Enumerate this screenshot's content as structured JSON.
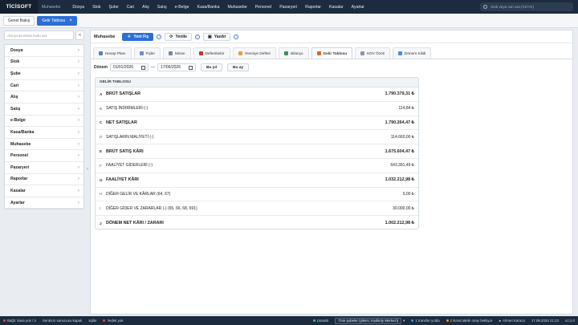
{
  "app": {
    "logo": "TİCİSOFT",
    "module": "Muhasebe"
  },
  "topmenu": [
    "Dosya",
    "Stok",
    "Şube",
    "Cari",
    "Alış",
    "Satış",
    "e-Belge",
    "Kasa/Banka",
    "Muhasebe",
    "Personel",
    "Pazaryeri",
    "Raporlar",
    "Kasalar",
    "Ayarlar"
  ],
  "search": {
    "placeholder": "Stok veya cari ara (Ctrl+K)"
  },
  "tabs": [
    {
      "label": "Genel Bakış"
    },
    {
      "label": "Gelir Tablosu"
    }
  ],
  "sidebar": {
    "search_placeholder": "Ara ya da ekran kodu yaz",
    "collapse": "«",
    "items": [
      "Dosya",
      "Stok",
      "Şube",
      "Cari",
      "Alış",
      "Satış",
      "e-Belge",
      "Kasa/Banka",
      "Muhasebe",
      "Personel",
      "Pazaryeri",
      "Raporlar",
      "Kasalar",
      "Ayarlar"
    ]
  },
  "toolbar": {
    "title": "Muhasebe",
    "new_label": "Yeni Fiş",
    "refresh_label": "Yenile",
    "print_label": "Yazdır"
  },
  "subtabs": [
    {
      "label": "Hesap Planı",
      "color": "#5b7fb5"
    },
    {
      "label": "Fişler",
      "color": "#6c8fc9"
    },
    {
      "label": "Mizan",
      "color": "#7a8899"
    },
    {
      "label": "Defterikebir",
      "color": "#c0392b"
    },
    {
      "label": "Yevmiye Defteri",
      "color": "#d9a441"
    },
    {
      "label": "Bilanço",
      "color": "#3b8f5a"
    },
    {
      "label": "Gelir Tablosu",
      "color": "#e0662b"
    },
    {
      "label": "KDV Özeti",
      "color": "#8a96a8"
    },
    {
      "label": "Dönem Kilidi",
      "color": "#4d8fd1"
    }
  ],
  "period": {
    "label": "Dönem",
    "start": "01/01/2026",
    "separator": "—",
    "end": "17/09/2026",
    "this_year": "Bu yıl",
    "this_month": "Bu ay"
  },
  "report": {
    "title": "GELİR TABLOSU",
    "rows": [
      {
        "code": "A",
        "label": "BRÜT SATIŞLAR",
        "value": "1.790.379,31 ₺",
        "bold": true
      },
      {
        "code": "B",
        "label": "SATIŞ İNDİRİMLERİ (-)",
        "value": "114,84 ₺",
        "bold": false
      },
      {
        "code": "C",
        "label": "NET SATIŞLAR",
        "value": "1.790.264,47 ₺",
        "bold": true
      },
      {
        "code": "D",
        "label": "SATIŞLARIN MALİYETİ (-)",
        "value": "114.660,00 ₺",
        "bold": false
      },
      {
        "code": "E",
        "label": "BRÜT SATIŞ KÂRI",
        "value": "1.675.604,47 ₺",
        "bold": true
      },
      {
        "code": "F",
        "label": "FAALİYET GİDERLERİ (-)",
        "value": "643.391,49 ₺",
        "bold": false
      },
      {
        "code": "G",
        "label": "FAALİYET KÂRI",
        "value": "1.032.212,98 ₺",
        "bold": true
      },
      {
        "code": "H",
        "label": "DİĞER GELİR VE KÂRLAR (64, 67)",
        "value": "0,00 ₺",
        "bold": false
      },
      {
        "code": "I",
        "label": "DİĞER GİDER VE ZARARLAR (-) (65, 66, 68, 691)",
        "value": "30.000,00 ₺",
        "bold": false
      },
      {
        "code": "J",
        "label": "DÖNEM NET KÂRI / ZARARI",
        "value": "1.002.212,98 ₺",
        "bold": true
      }
    ]
  },
  "statusbar": {
    "bagli": "Bağlı: kasa yok / 3",
    "server": "Senkron sunucusu kapalı",
    "mode": "sqlite",
    "backup": "Yedek yok",
    "license": "Lisanslı",
    "branch": "Tüm şubeler (şikesı: Kadıköy Merkezi)",
    "transfer": "1 transfer yolda",
    "pending": "2 ikmal talebi onay bekliyor",
    "user": "Ahmet Karaca",
    "datetime": "17.09.2026 21:23",
    "version": "v2.2.0"
  },
  "colors": {
    "topbar": "#1c2b3d",
    "accent": "#2b6fd6"
  }
}
